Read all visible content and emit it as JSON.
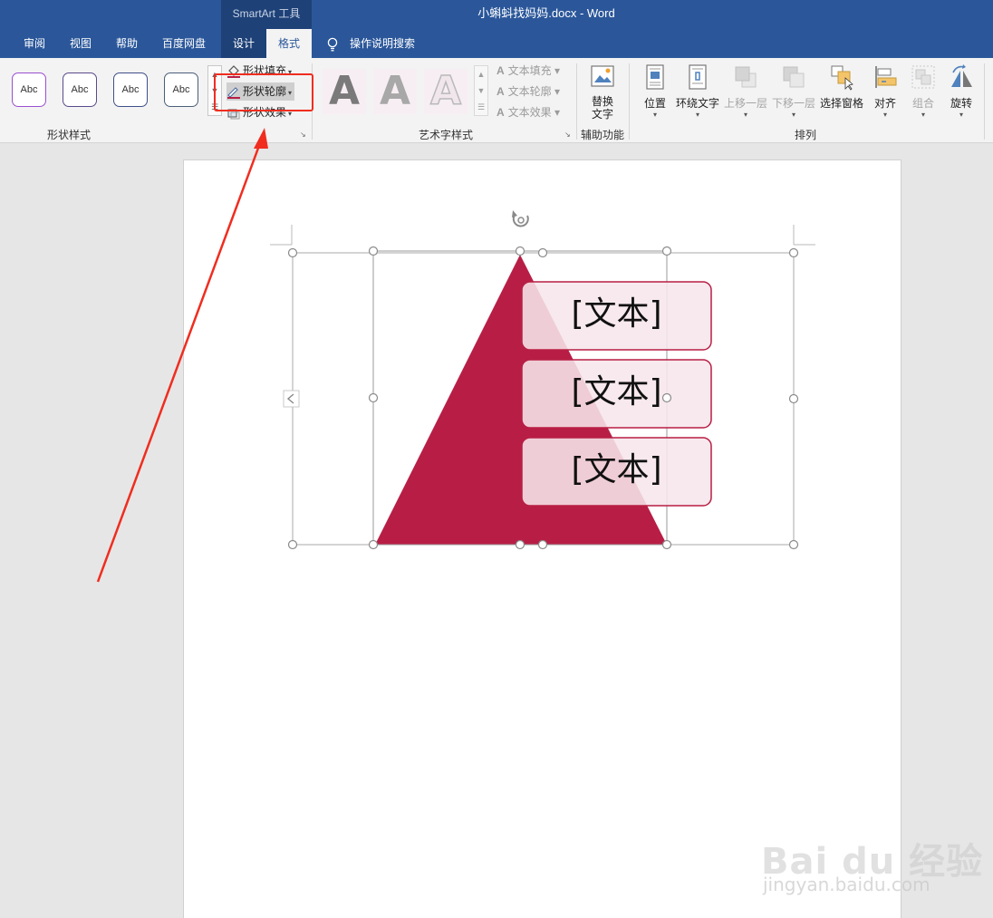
{
  "window": {
    "context_tab_group": "SmartArt 工具",
    "title": "小蝌蚪找妈妈.docx  -  Word"
  },
  "tabs": [
    {
      "label": "审阅"
    },
    {
      "label": "视图"
    },
    {
      "label": "帮助"
    },
    {
      "label": "百度网盘"
    },
    {
      "label": "设计"
    },
    {
      "label": "格式"
    }
  ],
  "tell_me": "操作说明搜索",
  "ribbon": {
    "shape_styles": {
      "label": "形状样式",
      "samples": [
        "Abc",
        "Abc",
        "Abc",
        "Abc"
      ],
      "sample_border_colors": [
        "#9b4fcf",
        "#5a4a8a",
        "#3f4f8a",
        "#4a5f7a"
      ],
      "fill": "形状填充",
      "outline": "形状轮廓",
      "effects": "形状效果"
    },
    "wordart_styles": {
      "label": "艺术字样式",
      "letters": [
        "A",
        "A",
        "A"
      ],
      "text_fill": "文本填充",
      "text_outline": "文本轮廓",
      "text_effects": "文本效果"
    },
    "accessibility": {
      "label": "辅助功能",
      "alt_text": "替换文字"
    },
    "arrange": {
      "label": "排列",
      "position": "位置",
      "wrap_text": "环绕文字",
      "bring_forward": "上移一层",
      "send_backward": "下移一层",
      "selection_pane": "选择窗格",
      "align": "对齐",
      "group": "组合",
      "rotate": "旋转"
    }
  },
  "document": {
    "smartart_items": [
      "[文本]",
      "[文本]",
      "[文本]"
    ],
    "accent_color": "#b81e45"
  },
  "watermark": {
    "logo": "Bai du 经验",
    "url": "jingyan.baidu.com"
  },
  "colors": {
    "ribbon_blue": "#2b579a",
    "highlight_red": "#f02d1f"
  }
}
